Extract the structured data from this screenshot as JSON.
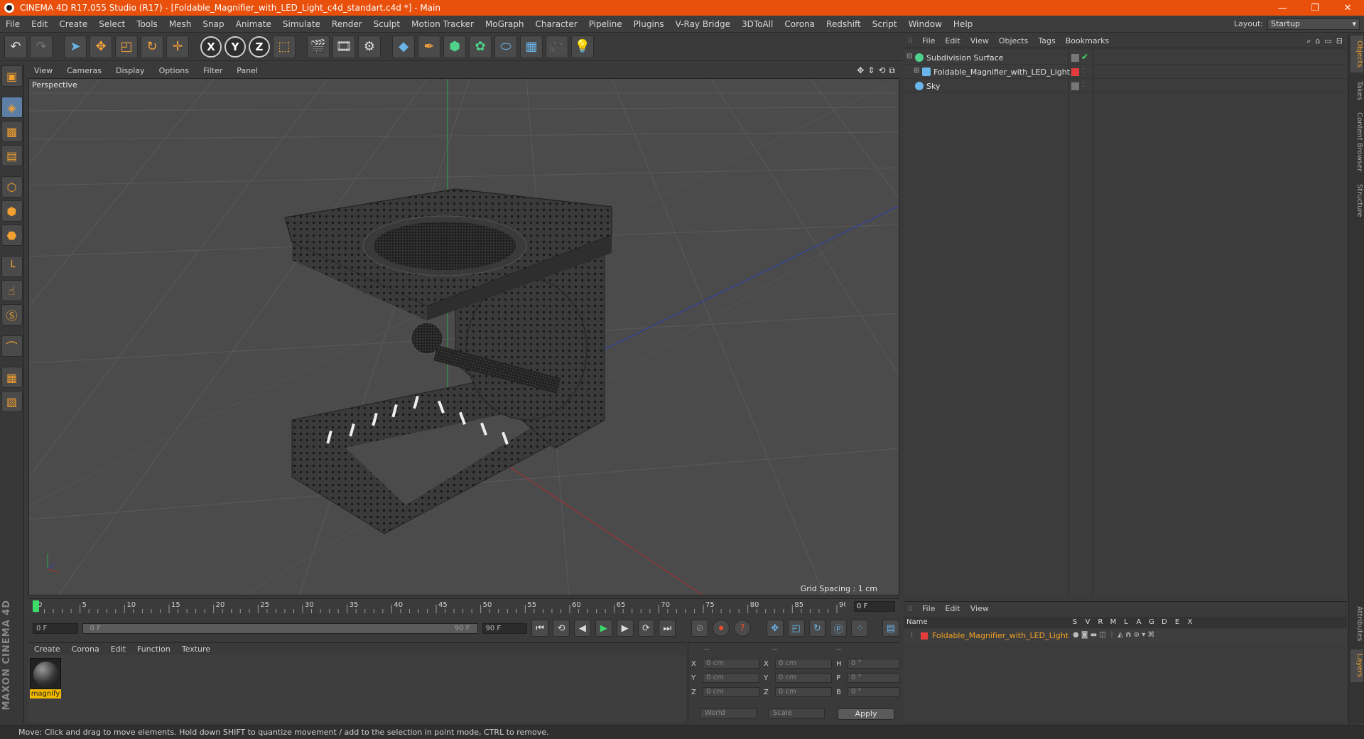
{
  "window": {
    "title": "CINEMA 4D R17.055 Studio (R17) - [Foldable_Magnifier_with_LED_Light_c4d_standart.c4d *] - Main",
    "minimize": "—",
    "restore": "❐",
    "close": "✕"
  },
  "menubar": {
    "items": [
      "File",
      "Edit",
      "Create",
      "Select",
      "Tools",
      "Mesh",
      "Snap",
      "Animate",
      "Simulate",
      "Render",
      "Sculpt",
      "Motion Tracker",
      "MoGraph",
      "Character",
      "Pipeline",
      "Plugins",
      "V-Ray Bridge",
      "3DToAll",
      "Corona",
      "Redshift",
      "Script",
      "Window",
      "Help"
    ],
    "layout_label": "Layout:",
    "layout_value": "Startup"
  },
  "viewport": {
    "menu": [
      "View",
      "Cameras",
      "Display",
      "Options",
      "Filter",
      "Panel"
    ],
    "label": "Perspective",
    "grid_spacing": "Grid Spacing : 1 cm"
  },
  "timeline": {
    "ticks": [
      "0",
      "5",
      "10",
      "15",
      "20",
      "25",
      "30",
      "35",
      "40",
      "45",
      "50",
      "55",
      "60",
      "65",
      "70",
      "75",
      "80",
      "85",
      "90"
    ],
    "frame_end": "0 F",
    "current_frame": 0
  },
  "transport": {
    "start_field": "0 F",
    "range_start": "0 F",
    "range_end": "90 F",
    "end_field": "90 F"
  },
  "materials": {
    "menu": [
      "Create",
      "Corona",
      "Edit",
      "Function",
      "Texture"
    ],
    "items": [
      {
        "name": "magnify"
      }
    ]
  },
  "coordinates": {
    "header": [
      "--",
      "--",
      "--"
    ],
    "rows": [
      {
        "a": "X",
        "av": "0 cm",
        "b": "X",
        "bv": "0 cm",
        "c": "H",
        "cv": "0 °"
      },
      {
        "a": "Y",
        "av": "0 cm",
        "b": "Y",
        "bv": "0 cm",
        "c": "P",
        "cv": "0 °"
      },
      {
        "a": "Z",
        "av": "0 cm",
        "b": "Z",
        "bv": "0 cm",
        "c": "B",
        "cv": "0 °"
      }
    ],
    "space": "World",
    "mode": "Scale",
    "apply": "Apply"
  },
  "objects": {
    "menu": [
      "File",
      "Edit",
      "View",
      "Objects",
      "Tags",
      "Bookmarks"
    ],
    "items": [
      {
        "name": "Subdivision Surface"
      },
      {
        "name": "Foldable_Magnifier_with_LED_Light"
      },
      {
        "name": "Sky"
      }
    ]
  },
  "layers": {
    "menu": [
      "File",
      "Edit",
      "View"
    ],
    "columns": [
      "Name",
      "S",
      "V",
      "R",
      "M",
      "L",
      "A",
      "G",
      "D",
      "E",
      "X"
    ],
    "items": [
      {
        "name": "Foldable_Magnifier_with_LED_Light"
      }
    ]
  },
  "side_tabs": [
    "Objects",
    "Takes",
    "Content Browser",
    "Structure",
    "Attributes",
    "Layers"
  ],
  "logo": "MAXON CINEMA 4D",
  "status": "Move: Click and drag to move elements. Hold down SHIFT to quantize movement / add to the selection in point mode, CTRL to remove.",
  "colors": {
    "title_bar": "#e8500c",
    "accent_orange": "#f0a030",
    "layer_red": "#e23c3c"
  }
}
